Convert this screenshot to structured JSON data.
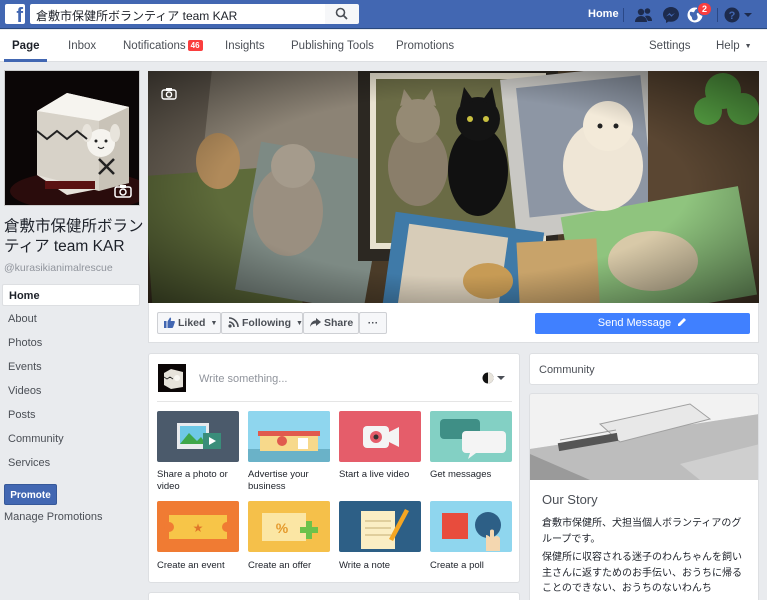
{
  "topbar": {
    "logo": "f",
    "search_value": "倉敷市保健所ボランティア team KAR",
    "home": "Home",
    "friend_requests_icon": "friends-icon",
    "messenger_icon": "messenger-icon",
    "notifications_icon": "globe-icon",
    "notifications_count": "2",
    "help_icon": "help-icon",
    "colors": {
      "bar": "#4267b2",
      "badge": "#fa3e3e"
    }
  },
  "pagenav": {
    "tabs": [
      {
        "label": "Page"
      },
      {
        "label": "Inbox"
      },
      {
        "label": "Notifications",
        "badge": "46"
      },
      {
        "label": "Insights"
      },
      {
        "label": "Publishing Tools"
      },
      {
        "label": "Promotions"
      }
    ],
    "settings": "Settings",
    "help": "Help"
  },
  "profile": {
    "name": "倉敷市保健所ボランティア team KAR",
    "handle": "@kurasikianimalrescue"
  },
  "sidebar": {
    "items": [
      {
        "label": "Home"
      },
      {
        "label": "About"
      },
      {
        "label": "Photos"
      },
      {
        "label": "Events"
      },
      {
        "label": "Videos"
      },
      {
        "label": "Posts"
      },
      {
        "label": "Community"
      },
      {
        "label": "Services"
      }
    ],
    "promote": "Promote",
    "manage_promotions": "Manage Promotions"
  },
  "actions": {
    "liked": "Liked",
    "following": "Following",
    "share": "Share",
    "more": "···",
    "send_message": "Send Message"
  },
  "composer": {
    "placeholder": "Write something...",
    "tiles": [
      {
        "label": "Share a photo or video"
      },
      {
        "label": "Advertise your business"
      },
      {
        "label": "Start a live video"
      },
      {
        "label": "Get messages"
      },
      {
        "label": "Create an event"
      },
      {
        "label": "Create an offer"
      },
      {
        "label": "Write a note"
      },
      {
        "label": "Create a poll"
      }
    ]
  },
  "community": {
    "title": "Community"
  },
  "story": {
    "title": "Our Story",
    "paragraph1": "倉敷市保健所、犬担当個人ボランティアのグループです。",
    "paragraph2": "保健所に収容される迷子のわんちゃんを飼い主さんに返すためのお手伝い、おうちに帰ることのできない、おうちのないわんち"
  }
}
